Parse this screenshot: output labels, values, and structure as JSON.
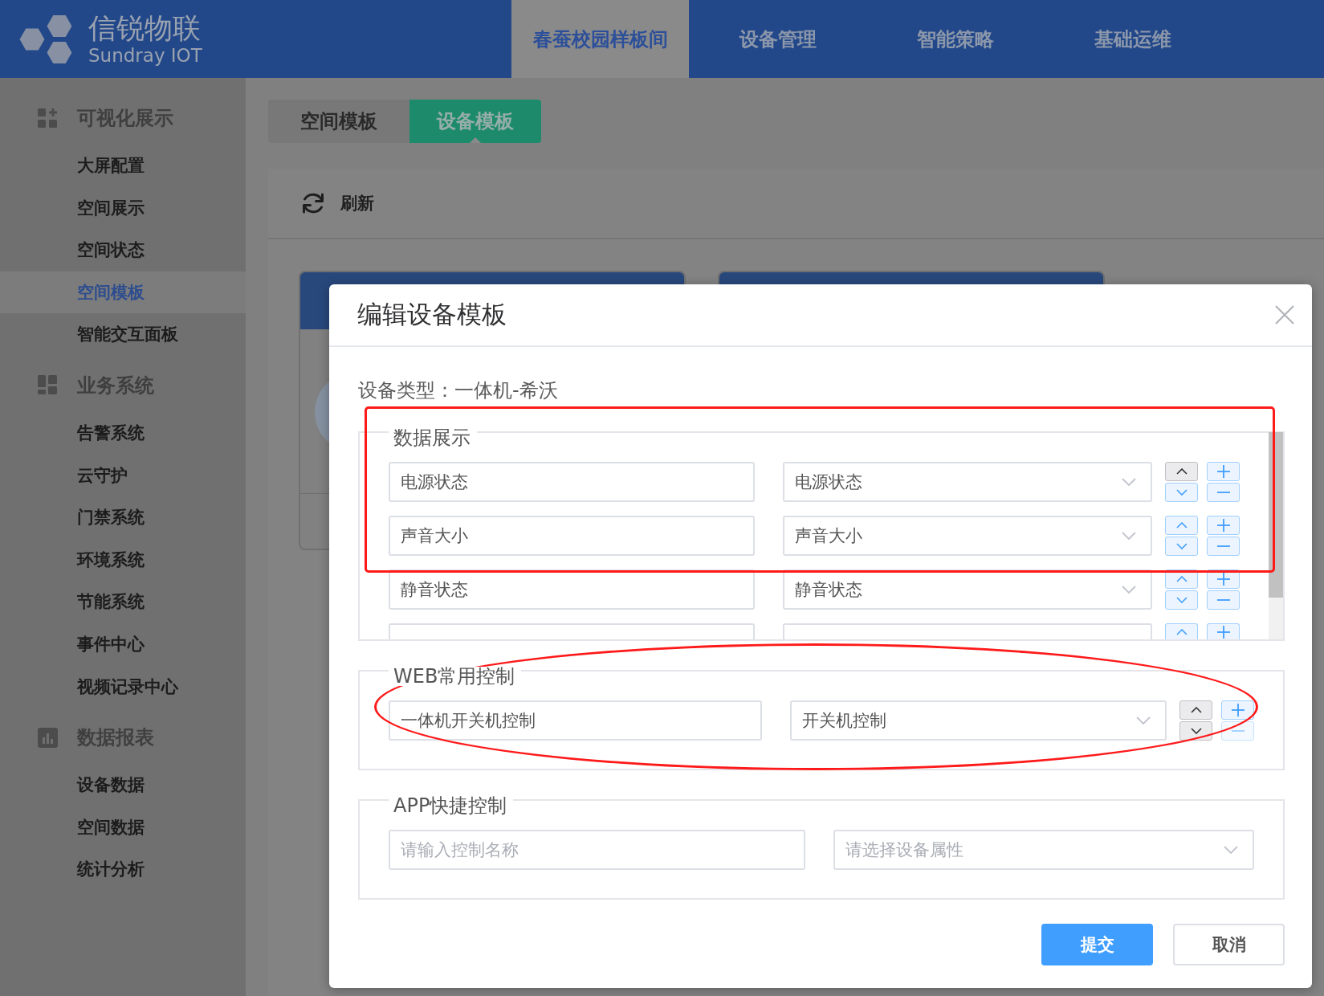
{
  "header": {
    "brand": "信锐物联",
    "subtitle": "Sundray IOT",
    "nav": [
      {
        "label": "春蚕校园样板间",
        "selected": true
      },
      {
        "label": "设备管理",
        "selected": false
      },
      {
        "label": "智能策略",
        "selected": false
      },
      {
        "label": "基础运维",
        "selected": false
      }
    ]
  },
  "sidebar": {
    "groups": [
      {
        "title": "可视化展示",
        "items": [
          {
            "label": "大屏配置",
            "selected": false
          },
          {
            "label": "空间展示",
            "selected": false
          },
          {
            "label": "空间状态",
            "selected": false
          },
          {
            "label": "空间模板",
            "selected": true
          },
          {
            "label": "智能交互面板",
            "selected": false
          }
        ]
      },
      {
        "title": "业务系统",
        "items": [
          {
            "label": "告警系统",
            "selected": false
          },
          {
            "label": "云守护",
            "selected": false
          },
          {
            "label": "门禁系统",
            "selected": false
          },
          {
            "label": "环境系统",
            "selected": false
          },
          {
            "label": "节能系统",
            "selected": false
          },
          {
            "label": "事件中心",
            "selected": false
          },
          {
            "label": "视频记录中心",
            "selected": false
          }
        ]
      },
      {
        "title": "数据报表",
        "items": [
          {
            "label": "设备数据",
            "selected": false
          },
          {
            "label": "空间数据",
            "selected": false
          },
          {
            "label": "统计分析",
            "selected": false
          }
        ]
      }
    ]
  },
  "tabs": [
    {
      "label": "空间模板",
      "selected": false
    },
    {
      "label": "设备模板",
      "selected": true
    }
  ],
  "toolbar": {
    "refresh": "刷新"
  },
  "dialog": {
    "title": "编辑设备模板",
    "device_type": "设备类型：一体机-希沃",
    "data_display": {
      "title": "数据展示",
      "rows": [
        {
          "name": "电源状态",
          "attribute": "电源状态",
          "cut_off": false,
          "move_up_disabled": true,
          "move_down_disabled": false,
          "remove_disabled": false
        },
        {
          "name": "声音大小",
          "attribute": "声音大小",
          "cut_off": false,
          "move_up_disabled": false,
          "move_down_disabled": false,
          "remove_disabled": false
        },
        {
          "name": "静音状态",
          "attribute": "静音状态",
          "cut_off": false,
          "move_up_disabled": false,
          "move_down_disabled": false,
          "remove_disabled": false
        },
        {
          "cut_off": true,
          "move_up_disabled": false
        }
      ]
    },
    "web_controls": {
      "title": "WEB常用控制",
      "rows": [
        {
          "name": "一体机开关机控制",
          "attribute": "开关机控制",
          "cut_off": false,
          "move_up_disabled": true,
          "move_down_disabled": true,
          "remove_disabled": true
        }
      ]
    },
    "app_controls": {
      "title": "APP快捷控制",
      "name_field": {
        "placeholder": "请输入控制名称"
      },
      "attribute_field": {
        "placeholder": "请选择设备属性"
      }
    },
    "buttons": [
      {
        "label": "提交",
        "kind": "primary"
      },
      {
        "label": "取消",
        "kind": "default"
      }
    ]
  },
  "annotations": [
    {
      "kind": "rectangle"
    },
    {
      "kind": "ellipse"
    }
  ]
}
